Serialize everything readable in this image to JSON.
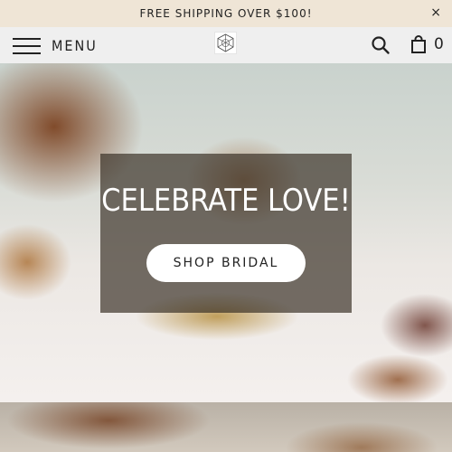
{
  "announcement": {
    "text": "FREE SHIPPING OVER $100!",
    "close_label": "×"
  },
  "header": {
    "menu_label": "MENU",
    "cart_count": "0",
    "icons": {
      "menu": "hamburger-icon",
      "logo": "geometric-logo",
      "search": "search-icon",
      "cart": "shopping-bag-icon"
    }
  },
  "hero": {
    "title": "CELEBRATE LOVE!",
    "button_label": "SHOP BRIDAL"
  },
  "colors": {
    "announcement_bg": "#efe5d6",
    "header_bg": "#efefef",
    "panel_bg": "rgba(55,45,35,0.68)",
    "text": "#222222"
  }
}
